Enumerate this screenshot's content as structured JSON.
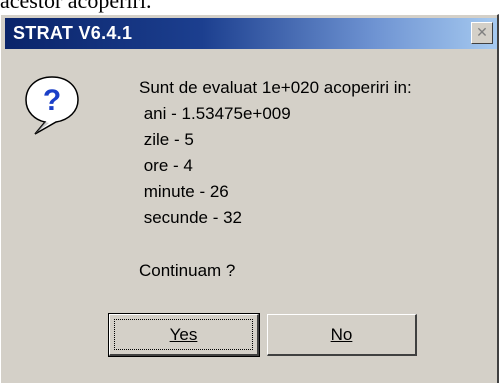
{
  "page_fragment": "acestor acoperiri.",
  "dialog": {
    "title": "STRAT V6.4.1",
    "close_glyph": "✕",
    "icon": "question-icon",
    "message_lines": [
      "Sunt de evaluat 1e+020 acoperiri in:",
      " ani - 1.53475e+009",
      " zile - 5",
      " ore - 4",
      " minute - 26",
      " secunde - 32",
      "Continuam ?"
    ],
    "buttons": {
      "yes": "Yes",
      "no": "No"
    }
  },
  "colors": {
    "titlebar_start": "#0a246a",
    "titlebar_end": "#a6caf0",
    "dialog_face": "#d4d0c8"
  }
}
